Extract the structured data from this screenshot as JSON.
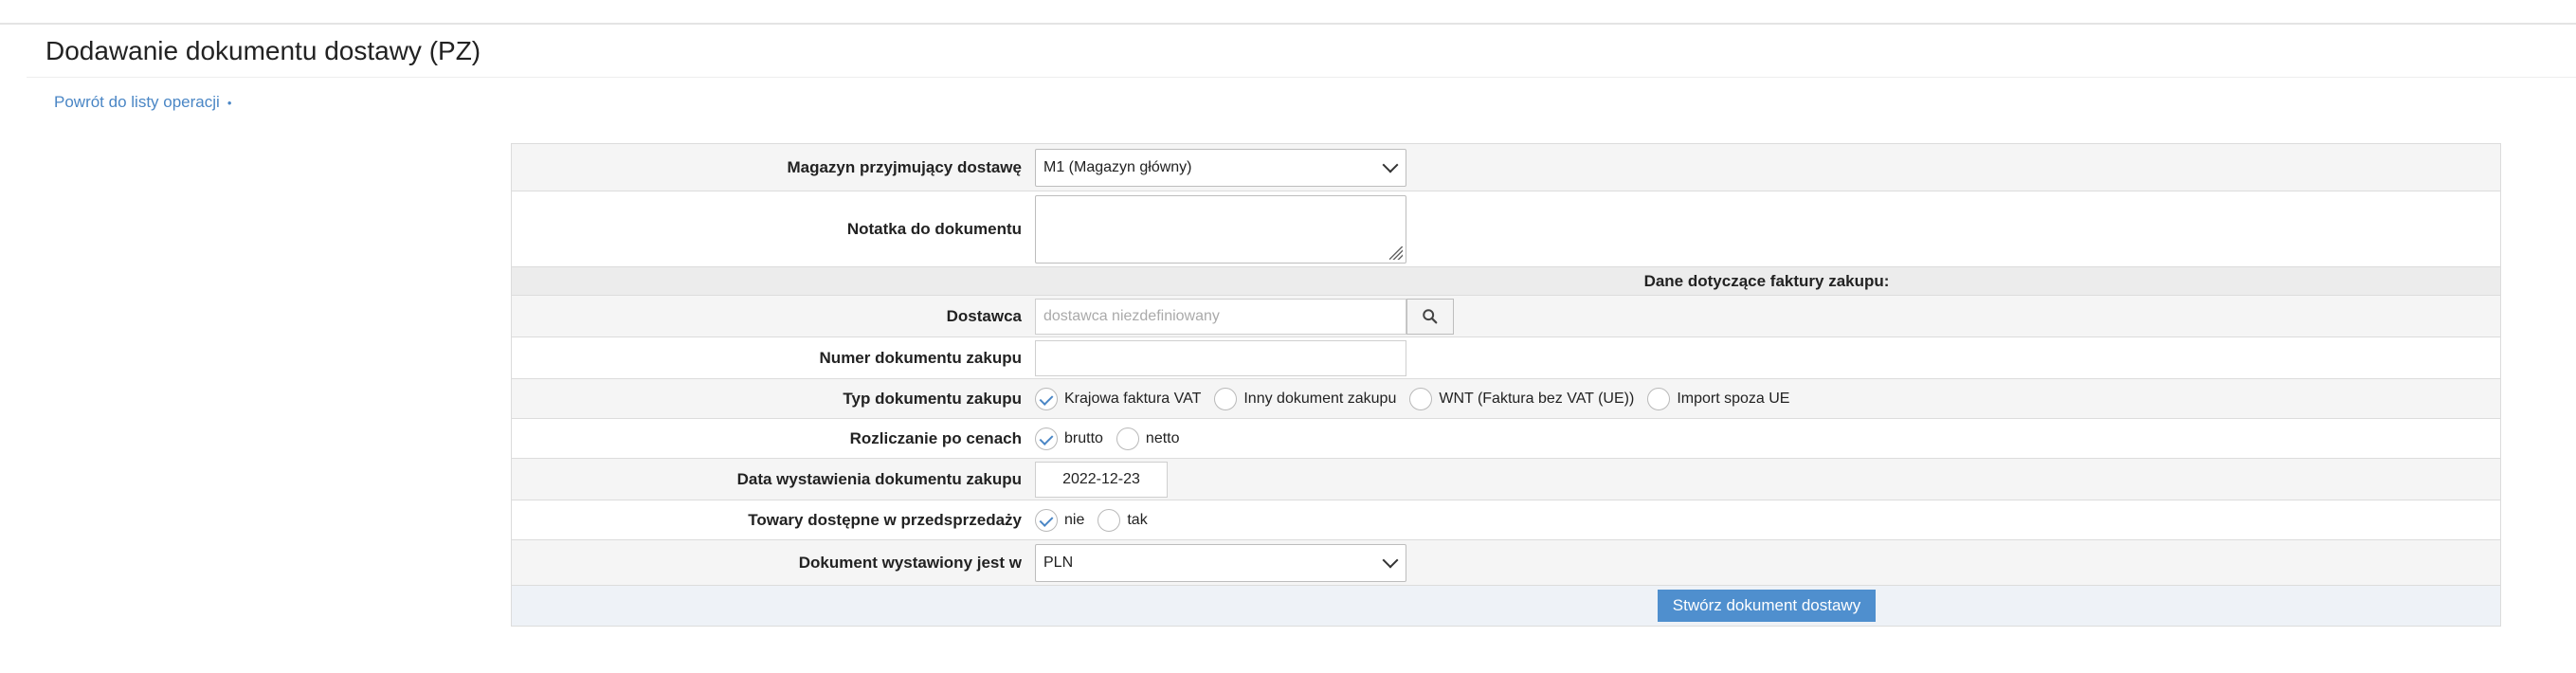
{
  "page": {
    "title": "Dodawanie dokumentu dostawy (PZ)",
    "back_link": "Powrót do listy operacji",
    "back_link_suffix": "•"
  },
  "form": {
    "warehouse": {
      "label": "Magazyn przyjmujący dostawę",
      "value": "M1 (Magazyn główny)"
    },
    "note": {
      "label": "Notatka do dokumentu",
      "value": ""
    },
    "section_header": "Dane dotyczące faktury zakupu:",
    "supplier": {
      "label": "Dostawca",
      "placeholder": "dostawca niezdefiniowany",
      "search_icon": "search-icon"
    },
    "doc_number": {
      "label": "Numer dokumentu zakupu",
      "value": ""
    },
    "doc_type": {
      "label": "Typ dokumentu zakupu",
      "options": [
        {
          "label": "Krajowa faktura VAT",
          "checked": true
        },
        {
          "label": "Inny dokument zakupu",
          "checked": false
        },
        {
          "label": "WNT (Faktura bez VAT (UE))",
          "checked": false
        },
        {
          "label": "Import spoza UE",
          "checked": false
        }
      ]
    },
    "pricing": {
      "label": "Rozliczanie po cenach",
      "options": [
        {
          "label": "brutto",
          "checked": true
        },
        {
          "label": "netto",
          "checked": false
        }
      ]
    },
    "issue_date": {
      "label": "Data wystawienia dokumentu zakupu",
      "value": "2022-12-23"
    },
    "presale": {
      "label": "Towary dostępne w przedsprzedaży",
      "options": [
        {
          "label": "nie",
          "checked": true
        },
        {
          "label": "tak",
          "checked": false
        }
      ]
    },
    "currency": {
      "label": "Dokument wystawiony jest w",
      "value": "PLN"
    },
    "submit_label": "Stwórz dokument dostawy"
  },
  "colors": {
    "accent": "#4f8fce",
    "link": "#4a86c5",
    "row_alt": "#f5f5f5"
  }
}
